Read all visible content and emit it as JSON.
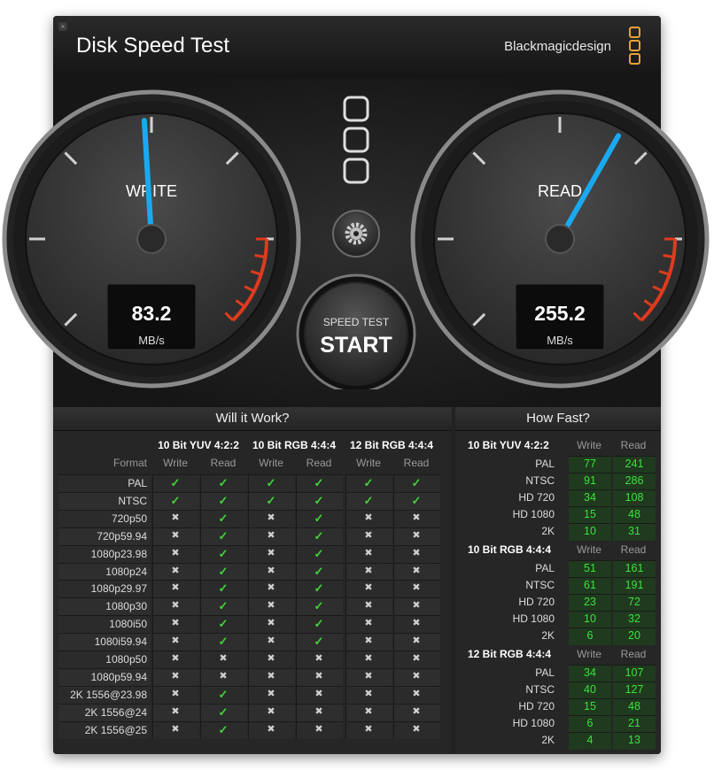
{
  "window": {
    "title": "Disk Speed Test",
    "brand": "Blackmagicdesign",
    "close_symbol": "×"
  },
  "gauges": {
    "write": {
      "label": "WRITE",
      "value": "83.2",
      "unit": "MB/s"
    },
    "read": {
      "label": "READ",
      "value": "255.2",
      "unit": "MB/s"
    }
  },
  "start_button": {
    "line1": "SPEED TEST",
    "line2": "START"
  },
  "will_it_work": {
    "title": "Will it Work?",
    "format_label": "Format",
    "groups": [
      "10 Bit YUV 4:2:2",
      "10 Bit RGB 4:4:4",
      "12 Bit RGB 4:4:4"
    ],
    "write_label": "Write",
    "read_label": "Read",
    "rows": [
      {
        "format": "PAL",
        "marks": [
          "✓",
          "✓",
          "✓",
          "✓",
          "✓",
          "✓"
        ]
      },
      {
        "format": "NTSC",
        "marks": [
          "✓",
          "✓",
          "✓",
          "✓",
          "✓",
          "✓"
        ]
      },
      {
        "format": "720p50",
        "marks": [
          "✖",
          "✓",
          "✖",
          "✓",
          "✖",
          "✖"
        ]
      },
      {
        "format": "720p59.94",
        "marks": [
          "✖",
          "✓",
          "✖",
          "✓",
          "✖",
          "✖"
        ]
      },
      {
        "format": "1080p23.98",
        "marks": [
          "✖",
          "✓",
          "✖",
          "✓",
          "✖",
          "✖"
        ]
      },
      {
        "format": "1080p24",
        "marks": [
          "✖",
          "✓",
          "✖",
          "✓",
          "✖",
          "✖"
        ]
      },
      {
        "format": "1080p29.97",
        "marks": [
          "✖",
          "✓",
          "✖",
          "✓",
          "✖",
          "✖"
        ]
      },
      {
        "format": "1080p30",
        "marks": [
          "✖",
          "✓",
          "✖",
          "✓",
          "✖",
          "✖"
        ]
      },
      {
        "format": "1080i50",
        "marks": [
          "✖",
          "✓",
          "✖",
          "✓",
          "✖",
          "✖"
        ]
      },
      {
        "format": "1080i59.94",
        "marks": [
          "✖",
          "✓",
          "✖",
          "✓",
          "✖",
          "✖"
        ]
      },
      {
        "format": "1080p50",
        "marks": [
          "✖",
          "✖",
          "✖",
          "✖",
          "✖",
          "✖"
        ]
      },
      {
        "format": "1080p59.94",
        "marks": [
          "✖",
          "✖",
          "✖",
          "✖",
          "✖",
          "✖"
        ]
      },
      {
        "format": "2K 1556@23.98",
        "marks": [
          "✖",
          "✓",
          "✖",
          "✖",
          "✖",
          "✖"
        ]
      },
      {
        "format": "2K 1556@24",
        "marks": [
          "✖",
          "✓",
          "✖",
          "✖",
          "✖",
          "✖"
        ]
      },
      {
        "format": "2K 1556@25",
        "marks": [
          "✖",
          "✓",
          "✖",
          "✖",
          "✖",
          "✖"
        ]
      }
    ]
  },
  "how_fast": {
    "title": "How Fast?",
    "write_label": "Write",
    "read_label": "Read",
    "sections": [
      {
        "name": "10 Bit YUV 4:2:2",
        "rows": [
          {
            "format": "PAL",
            "write": "77",
            "read": "241"
          },
          {
            "format": "NTSC",
            "write": "91",
            "read": "286"
          },
          {
            "format": "HD 720",
            "write": "34",
            "read": "108"
          },
          {
            "format": "HD 1080",
            "write": "15",
            "read": "48"
          },
          {
            "format": "2K",
            "write": "10",
            "read": "31"
          }
        ]
      },
      {
        "name": "10 Bit RGB 4:4:4",
        "rows": [
          {
            "format": "PAL",
            "write": "51",
            "read": "161"
          },
          {
            "format": "NTSC",
            "write": "61",
            "read": "191"
          },
          {
            "format": "HD 720",
            "write": "23",
            "read": "72"
          },
          {
            "format": "HD 1080",
            "write": "10",
            "read": "32"
          },
          {
            "format": "2K",
            "write": "6",
            "read": "20"
          }
        ]
      },
      {
        "name": "12 Bit RGB 4:4:4",
        "rows": [
          {
            "format": "PAL",
            "write": "34",
            "read": "107"
          },
          {
            "format": "NTSC",
            "write": "40",
            "read": "127"
          },
          {
            "format": "HD 720",
            "write": "15",
            "read": "48"
          },
          {
            "format": "HD 1080",
            "write": "6",
            "read": "21"
          },
          {
            "format": "2K",
            "write": "4",
            "read": "13"
          }
        ]
      }
    ]
  },
  "colors": {
    "needle": "#1aa9f0",
    "check": "#41d43c",
    "number": "#3be23b",
    "redzone": "#e03a1e",
    "logo": "#e8a33a"
  }
}
